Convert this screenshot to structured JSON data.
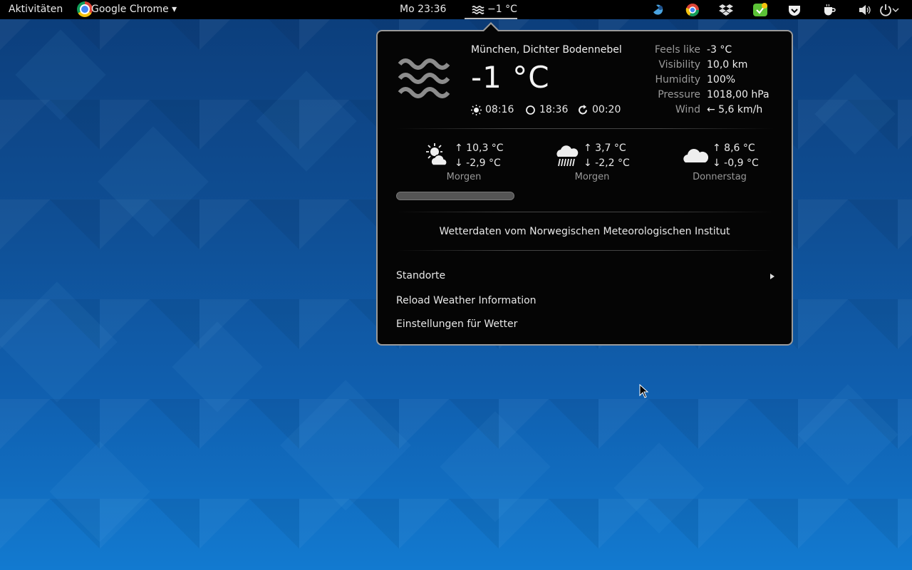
{
  "topbar": {
    "activities": "Aktivitäten",
    "app_menu": "Google Chrome ▾",
    "clock": "Mo 23:36",
    "weather_temp": "−1 °C"
  },
  "weather": {
    "location": "München, Dichter Bodennebel",
    "temperature": "-1 °C",
    "sunrise": "08:16",
    "sunset": "18:36",
    "updated": "00:20",
    "details": [
      {
        "label": "Feels like",
        "value": "-3 °C"
      },
      {
        "label": "Visibility",
        "value": "10,0 km"
      },
      {
        "label": "Humidity",
        "value": "100%"
      },
      {
        "label": "Pressure",
        "value": "1018,00 hPa"
      },
      {
        "label": "Wind",
        "value": "← 5,6 km/h"
      }
    ],
    "forecast": [
      {
        "icon": "sun-cloud-icon",
        "high": "↑ 10,3 °C",
        "low": "↓ -2,9 °C",
        "day": "Morgen"
      },
      {
        "icon": "rain-icon",
        "high": "↑ 3,7 °C",
        "low": "↓ -2,2 °C",
        "day": "Morgen"
      },
      {
        "icon": "cloud-icon",
        "high": "↑ 8,6 °C",
        "low": "↓ -0,9 °C",
        "day": "Donnerstag"
      }
    ],
    "attribution": "Wetterdaten vom Norwegischen Meteorologischen Institut"
  },
  "menu": {
    "locations": "Standorte",
    "reload": "Reload Weather Information",
    "settings": "Einstellungen für Wetter"
  },
  "colors": {
    "panel": "#000000",
    "popup_bg": "#050505",
    "popup_border": "#9a9a9a"
  }
}
